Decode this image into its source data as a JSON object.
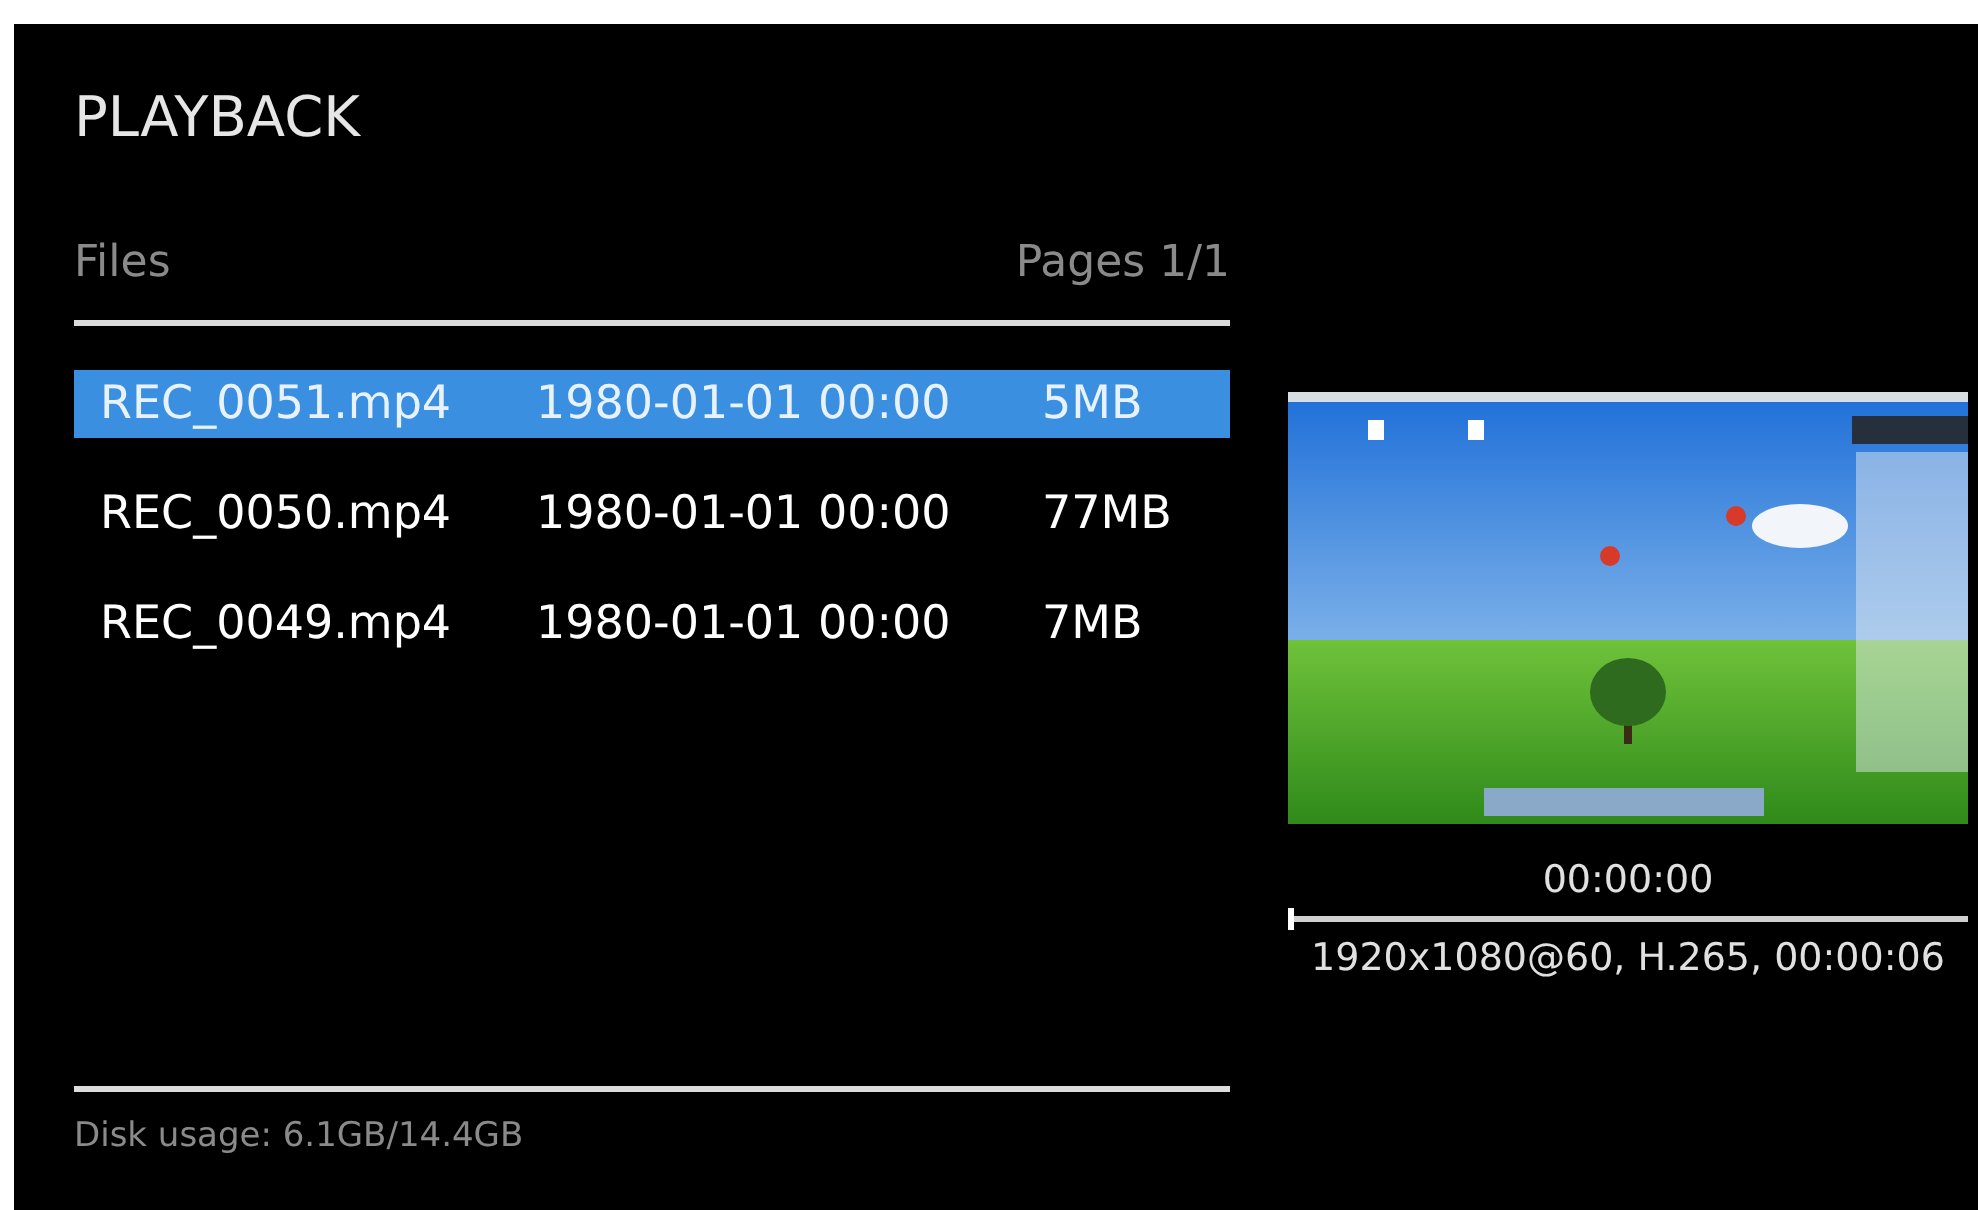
{
  "title": "PLAYBACK",
  "files_header": {
    "label": "Files",
    "pages": "Pages 1/1"
  },
  "files": [
    {
      "name": "REC_0051.mp4",
      "date": "1980-01-01 00:00",
      "size": "5MB",
      "selected": true
    },
    {
      "name": "REC_0050.mp4",
      "date": "1980-01-01 00:00",
      "size": "77MB",
      "selected": false
    },
    {
      "name": "REC_0049.mp4",
      "date": "1980-01-01 00:00",
      "size": "7MB",
      "selected": false
    }
  ],
  "disk_usage": "Disk usage: 6.1GB/14.4GB",
  "preview": {
    "time": "00:00:00",
    "progress": {
      "level": 0
    },
    "info": "1920x1080@60, H.265, 00:00:06"
  }
}
